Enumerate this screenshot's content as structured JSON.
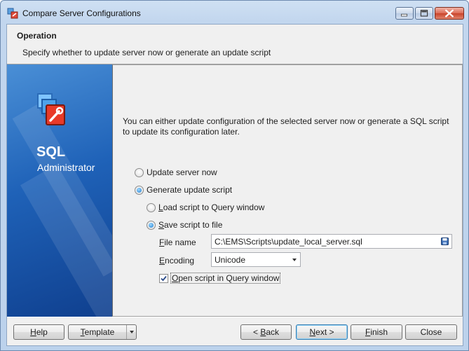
{
  "window": {
    "title": "Compare Server Configurations",
    "controls": [
      "minimize-icon",
      "maximize-icon",
      "close-icon"
    ]
  },
  "header": {
    "title": "Operation",
    "subtitle": "Specify whether to update server now or generate an update script"
  },
  "sidebar": {
    "logo_icon": "sql-administrator-logo-icon",
    "title": "SQL",
    "subtitle": "Administrator",
    "gradient_colors": [
      "#4a8fd6",
      "#1f62b8",
      "#0f3f8e"
    ]
  },
  "main": {
    "description": "You can either update configuration of the selected server now or generate a SQL script to update its configuration later.",
    "options": {
      "update_now": {
        "label": "Update server now",
        "checked": false
      },
      "generate_script": {
        "label": "Generate update script",
        "checked": true
      },
      "load_to_query": {
        "label_prefix": "L",
        "label_rest": "oad script to Query window",
        "checked": false
      },
      "save_to_file": {
        "label_prefix": "S",
        "label_rest": "ave script to file",
        "checked": true
      }
    },
    "file_name": {
      "label_prefix": "F",
      "label_rest": "ile name",
      "value": "C:\\EMS\\Scripts\\update_local_server.sql",
      "icon": "save-icon"
    },
    "encoding": {
      "label_prefix": "E",
      "label_rest": "ncoding",
      "value": "Unicode"
    },
    "open_in_query": {
      "label_prefix": "O",
      "label_rest": "pen script in Query window",
      "checked": true
    }
  },
  "buttons": {
    "help": {
      "prefix": "H",
      "rest": "elp"
    },
    "template": {
      "prefix": "T",
      "rest": "emplate"
    },
    "back": {
      "before": "< ",
      "prefix": "B",
      "rest": "ack"
    },
    "next": {
      "prefix": "N",
      "rest": "ext >"
    },
    "finish": {
      "prefix": "F",
      "rest": "inish"
    },
    "close": {
      "label": "Close"
    }
  },
  "colors": {
    "accent": "#1f7fd0",
    "window_frame": "#c2d6ee",
    "default_button_border": "#3c7fb1"
  }
}
